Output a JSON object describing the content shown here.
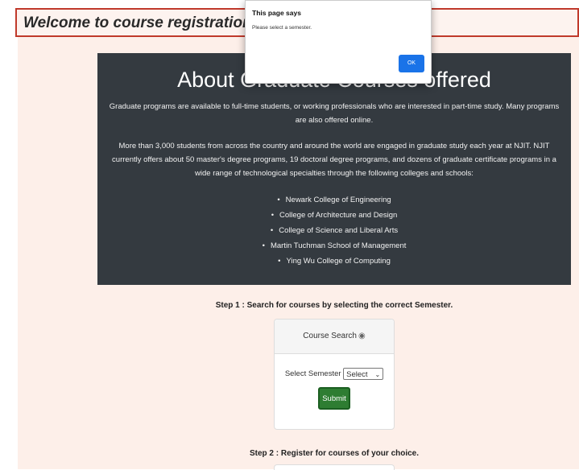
{
  "header": {
    "title": "Welcome to course registration site of"
  },
  "about": {
    "heading": "About Graduate Courses offered",
    "para1": "Graduate programs are available to full-time students, or working professionals who are interested in part-time study. Many programs are also offered online.",
    "para2": "More than 3,000 students from across the country and around the world are engaged in graduate study each year at NJIT. NJIT currently offers about 50 master's degree programs, 19 doctoral degree programs, and dozens of graduate certificate programs in a wide range of technological specialties through the following colleges and schools:",
    "colleges": [
      "Newark College of Engineering",
      "College of Architecture and Design",
      "College of Science and Liberal Arts",
      "Martin Tuchman School of Management",
      "Ying Wu College of Computing"
    ]
  },
  "step1": {
    "label": "Step 1 : Search for courses by selecting the correct Semester."
  },
  "search_card": {
    "title": "Course Search",
    "radio_icon": "radio-icon",
    "select_label": "Select Semester",
    "select_value": "Select",
    "submit_label": "Submit"
  },
  "step2": {
    "label": "Step 2 : Register for courses of your choice."
  },
  "dialog": {
    "title": "This page says",
    "message": "Please select a semester.",
    "ok_label": "OK"
  },
  "colors": {
    "page_background": "#fdefe9",
    "about_background": "#343a40",
    "submit_button": "#2e7d32",
    "ok_button": "#1a73e8",
    "header_border": "#c0392b"
  }
}
